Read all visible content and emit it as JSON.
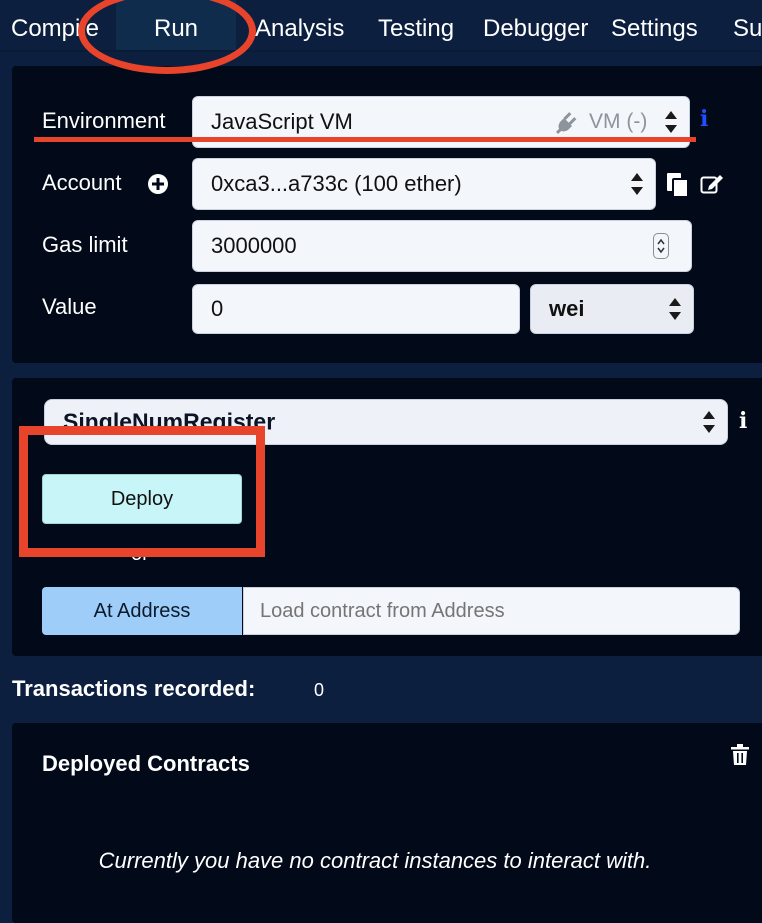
{
  "tabs": [
    {
      "label": "Compile"
    },
    {
      "label": "Run"
    },
    {
      "label": "Analysis"
    },
    {
      "label": "Testing"
    },
    {
      "label": "Debugger"
    },
    {
      "label": "Settings"
    },
    {
      "label": "Su"
    }
  ],
  "settings": {
    "environment_label": "Environment",
    "environment_value": "JavaScript VM",
    "environment_badge": "VM (-)",
    "account_label": "Account",
    "account_value": "0xca3...a733c (100 ether)",
    "gaslimit_label": "Gas limit",
    "gaslimit_value": "3000000",
    "value_label": "Value",
    "value_value": "0",
    "unit_value": "wei"
  },
  "contract": {
    "selected": "SingleNumRegister",
    "deploy_label": "Deploy",
    "or_label": "or",
    "at_address_label": "At Address",
    "address_placeholder": "Load contract from Address"
  },
  "transactions": {
    "label": "Transactions recorded:",
    "count": "0"
  },
  "deployed": {
    "title": "Deployed Contracts",
    "empty_message": "Currently you have no contract instances to interact with."
  },
  "icons": {
    "plug": "plug-icon",
    "info": "info-icon",
    "plus": "plus-circle-icon",
    "copy": "copy-icon",
    "edit": "edit-icon",
    "trash": "trash-icon",
    "chevron": "chevron-down-icon"
  },
  "colors": {
    "background": "#0c1f3f",
    "panel": "#020919",
    "deploy_button": "#c8f5f7",
    "at_address_button": "#9dcdf8",
    "annotation": "#e8432b",
    "info_blue": "#1f4fff"
  }
}
